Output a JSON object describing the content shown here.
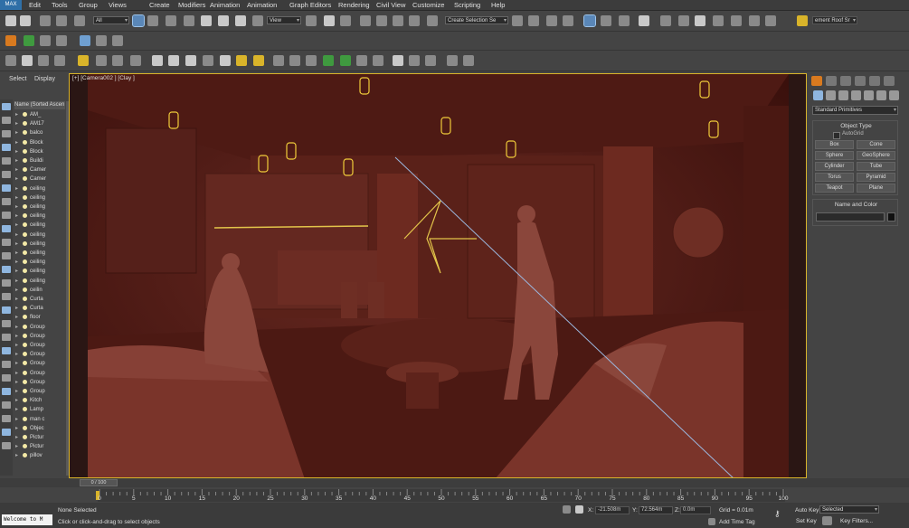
{
  "menu": {
    "app_label": "MAX",
    "items": [
      "Edit",
      "Tools",
      "Group",
      "Views",
      "Create",
      "Modifiers",
      "Animation",
      "Graph Editors",
      "Rendering",
      "Civil View",
      "Customize",
      "Scripting",
      "Help"
    ]
  },
  "toolbar": {
    "selection_filter": "All",
    "ref_coord": "View",
    "named_selection": "Create Selection Se",
    "workspace_label": "ement Roof Sr"
  },
  "left_panel": {
    "tabs": [
      "Select",
      "Display"
    ],
    "header": "Name (Sorted Ascen",
    "rows": [
      "AM_",
      "AM17",
      "balco",
      "Block",
      "Block",
      "Buildi",
      "Camer",
      "Camer",
      "ceiling",
      "ceiling",
      "ceiling",
      "ceiling",
      "ceiling",
      "ceiling",
      "ceiling",
      "ceiling",
      "ceiling",
      "ceiling",
      "ceiling",
      "ceilin",
      "Curta",
      "Curta",
      "floor",
      "Group",
      "Group",
      "Group",
      "Group",
      "Group",
      "Group",
      "Group",
      "Group",
      "Kitch",
      "Lamp",
      "man c",
      "Objec",
      "Pictur",
      "Pictur",
      "pillov"
    ]
  },
  "viewport": {
    "label": "[+] [Camera002 ] [Clay ]",
    "accent": "#d9b42a",
    "scene_tint": "#5a1d17"
  },
  "right_panel": {
    "category": "Standard Primitives",
    "object_type_title": "Object Type",
    "autogrid": "AutoGrid",
    "primitives": [
      "Box",
      "Cone",
      "Sphere",
      "GeoSphere",
      "Cylinder",
      "Tube",
      "Torus",
      "Pyramid",
      "Teapot",
      "Plane"
    ],
    "name_color_title": "Name and Color"
  },
  "timeline": {
    "slider": "0 / 100",
    "ticks": [
      "0",
      "5",
      "10",
      "15",
      "20",
      "25",
      "30",
      "35",
      "40",
      "45",
      "50",
      "55",
      "60",
      "65",
      "70",
      "75",
      "80",
      "85",
      "90",
      "95",
      "100"
    ]
  },
  "status": {
    "listener": "Welcome to M",
    "selection": "None Selected",
    "prompt": "Click or click-and-drag to select objects",
    "x_label": "X:",
    "x_value": "-21.508m",
    "y_label": "Y:",
    "y_value": "72.564m",
    "z_label": "Z:",
    "z_value": "0.0m",
    "grid": "Grid = 0.01m",
    "add_time_tag": "Add Time Tag",
    "auto_key": "Auto Key",
    "auto_key_value": "Selected",
    "set_key": "Set Key",
    "key_filters": "Key Filters..."
  }
}
